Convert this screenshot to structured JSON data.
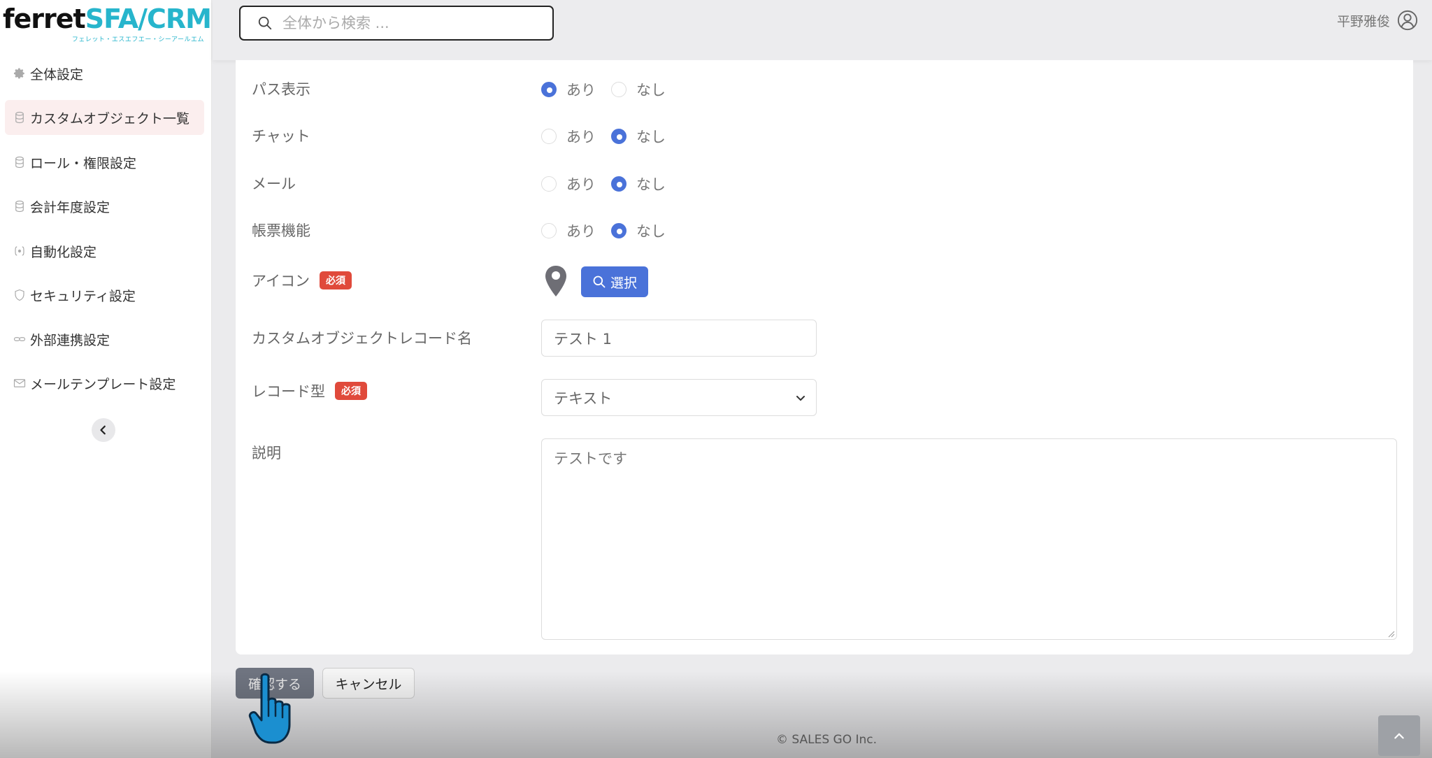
{
  "app": {
    "logo_main_a": "ferret",
    "logo_main_b": "SFA/CRM",
    "logo_sub": "フェレット・エスエフエー・シーアールエム"
  },
  "search": {
    "placeholder": "全体から検索 ..."
  },
  "user": {
    "name": "平野雅俊"
  },
  "sidebar": {
    "items": [
      {
        "label": "全体設定",
        "icon": "gear-icon"
      },
      {
        "label": "カスタムオブジェクト一覧",
        "icon": "database-icon",
        "active": true
      },
      {
        "label": "ロール・権限設定",
        "icon": "database-icon"
      },
      {
        "label": "会計年度設定",
        "icon": "database-icon"
      },
      {
        "label": "自動化設定",
        "icon": "automation-icon"
      },
      {
        "label": "セキュリティ設定",
        "icon": "shield-icon"
      },
      {
        "label": "外部連携設定",
        "icon": "link-icon"
      },
      {
        "label": "メールテンプレート設定",
        "icon": "mail-icon"
      }
    ]
  },
  "form": {
    "radio_yes": "あり",
    "radio_no": "なし",
    "rows": [
      {
        "label": "パス表示",
        "selected": "yes"
      },
      {
        "label": "チャット",
        "selected": "no"
      },
      {
        "label": "メール",
        "selected": "no"
      },
      {
        "label": "帳票機能",
        "selected": "no"
      }
    ],
    "icon_label": "アイコン",
    "required_badge": "必須",
    "icon_value": "map-pin-icon",
    "select_button": "選択",
    "record_name_label": "カスタムオブジェクトレコード名",
    "record_name_value": "テスト 1",
    "record_type_label": "レコード型",
    "record_type_value": "テキスト",
    "description_label": "説明",
    "description_value": "テストです"
  },
  "actions": {
    "confirm": "確認する",
    "cancel": "キャンセル"
  },
  "footer": {
    "copyright": "© SALES GO Inc."
  },
  "colors": {
    "accent": "#4a72d9",
    "required": "#e04a3b",
    "logo": "#27b5cc",
    "active_nav_bg": "#fbeeee"
  }
}
